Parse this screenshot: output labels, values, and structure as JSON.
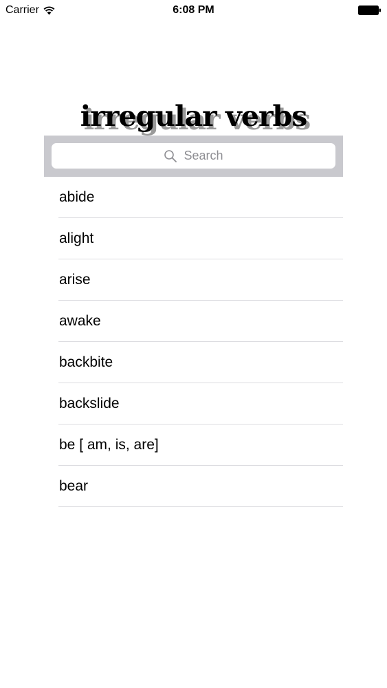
{
  "status_bar": {
    "carrier": "Carrier",
    "time": "6:08 PM",
    "wifi_icon": "wifi-icon",
    "battery_icon": "battery-full-icon"
  },
  "header": {
    "title": "irregular verbs"
  },
  "search": {
    "placeholder": "Search",
    "icon": "search-icon"
  },
  "verbs": [
    "abide",
    "alight",
    "arise",
    "awake",
    "backbite",
    "backslide",
    "be [ am, is, are]",
    "bear"
  ],
  "colors": {
    "search_bar_background": "#c9c9ce",
    "placeholder_text": "#8e8e93",
    "separator": "#dcdce0",
    "title_shadow": "#9a9a9a"
  }
}
